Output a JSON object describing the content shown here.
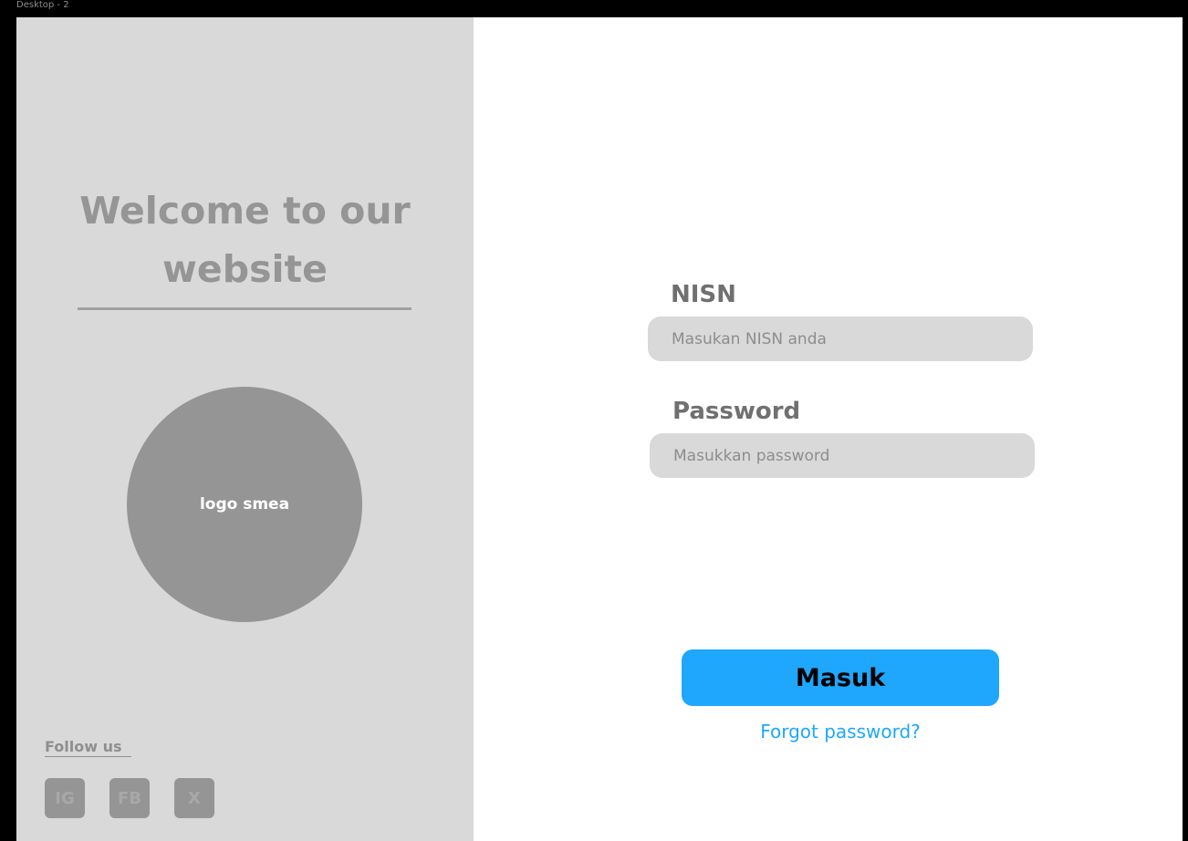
{
  "frame": {
    "label": "Desktop - 2"
  },
  "left_panel": {
    "welcome_line1": "Welcome to our",
    "welcome_line2": "website",
    "logo_text": "logo smea",
    "follow_label": "Follow us",
    "social": [
      {
        "label": "IG",
        "icon": "instagram-icon"
      },
      {
        "label": "FB",
        "icon": "facebook-icon"
      },
      {
        "label": "X",
        "icon": "x-icon"
      }
    ]
  },
  "form": {
    "nisn": {
      "label": "NISN",
      "placeholder": "Masukan NISN anda",
      "value": ""
    },
    "password": {
      "label": "Password",
      "placeholder": "Masukkan password",
      "value": ""
    },
    "submit_label": "Masuk",
    "forgot_label": "Forgot password?"
  },
  "colors": {
    "accent": "#1ea7fd",
    "panel": "#d9d9d9",
    "muted": "#959595",
    "background": "#000000"
  }
}
